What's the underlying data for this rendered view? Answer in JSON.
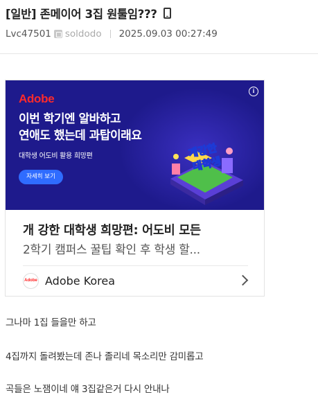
{
  "post": {
    "title": "[일반] 존메이어 3집 원툴임???",
    "author": "Lvc47501",
    "user_id": "soldodo",
    "date": "2025.09.03 00:27:49"
  },
  "ad": {
    "brand_logo": "Adobe",
    "banner_headline_1": "이번 학기엔 알바하고",
    "banner_headline_2": "연애도 했는데 과탑이래요",
    "banner_sub": "대학생 어도비 활용 희망편",
    "banner_cta": "자세히 보기",
    "art_text_1": "개강한",
    "art_text_2": "대학생",
    "title": "개 강한 대학생 희망편: 어도비 모든",
    "description": "2학기 캠퍼스 꿀팁 확인 후 학생 할...",
    "advertiser_logo": "Adobe",
    "advertiser_name": "Adobe Korea",
    "colors": {
      "banner_bg": "#1e1a8c",
      "brand_red": "#ff2a2a",
      "cta_blue": "#2f6cff"
    }
  },
  "content": {
    "lines": [
      "그나마 1집 들을만 하고",
      "4집까지 돌려봤는데 존나 졸리네 목소리만 감미롭고",
      "곡들은 노잼이네 얘 3집같은거 다시 안내나"
    ]
  }
}
